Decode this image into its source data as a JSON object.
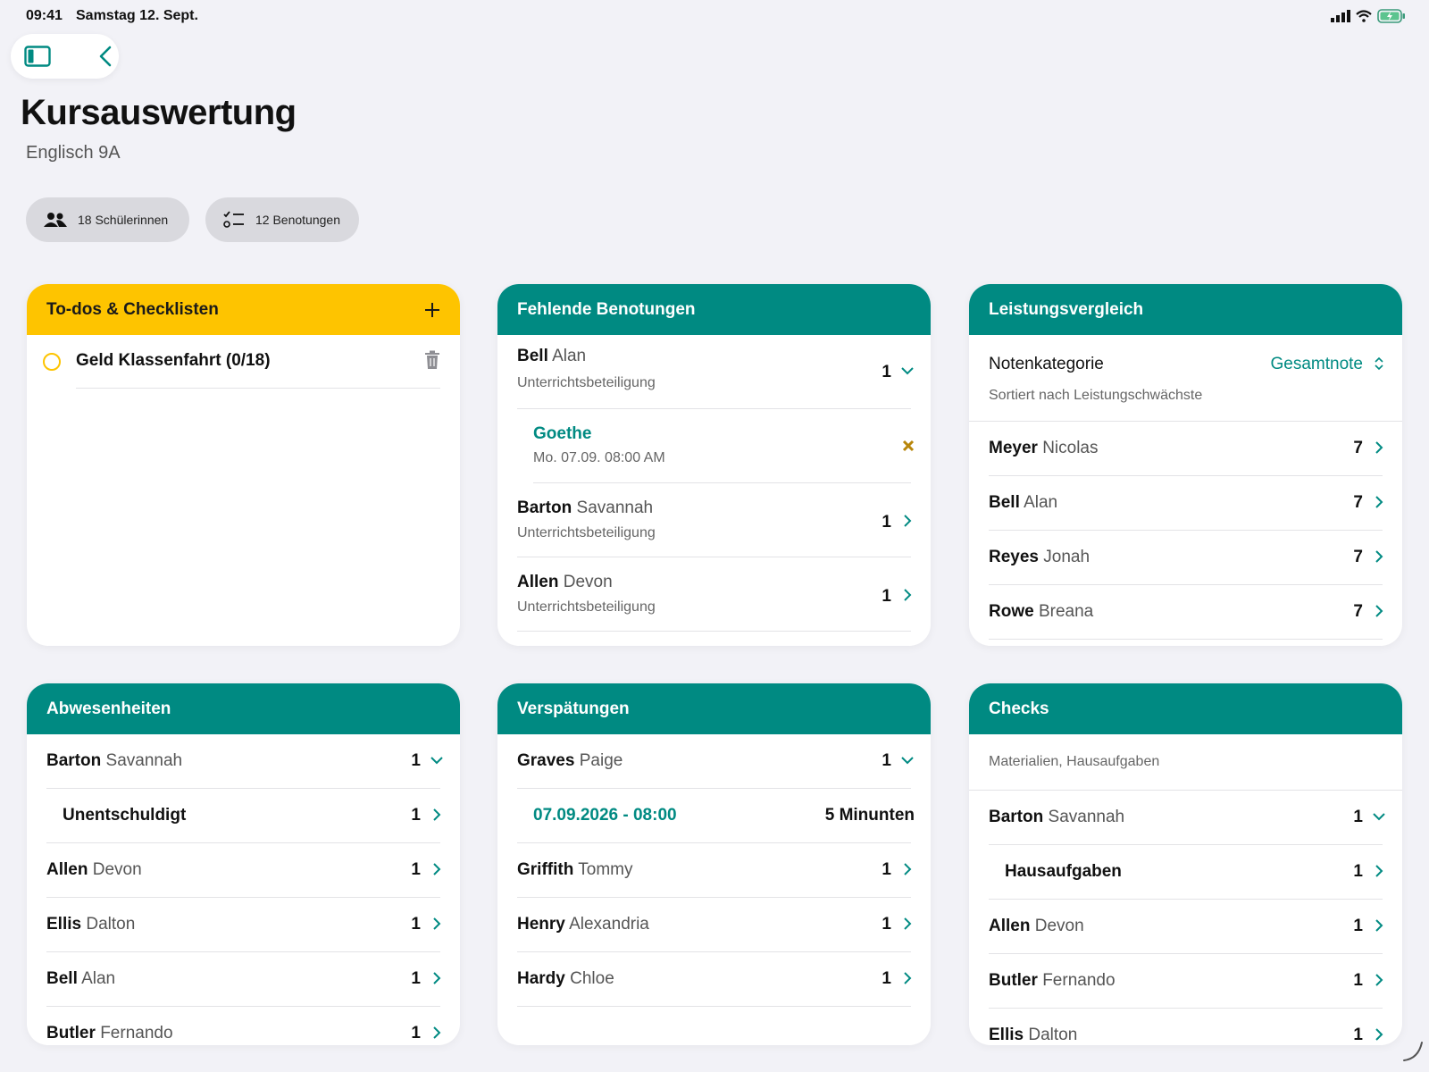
{
  "status": {
    "time": "09:41",
    "date": "Samstag 12. Sept."
  },
  "header": {
    "title": "Kursauswertung",
    "subtitle": "Englisch 9A"
  },
  "chips": {
    "students": "18 Schülerinnen",
    "grades": "12 Benotungen"
  },
  "todos": {
    "title": "To-dos & Checklisten",
    "items": [
      {
        "label": "Geld Klassenfahrt (0/18)"
      }
    ]
  },
  "missing": {
    "title": "Fehlende Benotungen",
    "rows": [
      {
        "last": "Bell",
        "first": "Alan",
        "sub": "Unterrichtsbeteiligung",
        "count": "1"
      },
      {
        "title": "Goethe",
        "sub": "Mo. 07.09. 08:00 AM"
      },
      {
        "last": "Barton",
        "first": "Savannah",
        "sub": "Unterrichtsbeteiligung",
        "count": "1"
      },
      {
        "last": "Allen",
        "first": "Devon",
        "sub": "Unterrichtsbeteiligung",
        "count": "1"
      }
    ]
  },
  "performance": {
    "title": "Leistungsvergleich",
    "category_label": "Notenkategorie",
    "category_value": "Gesamtnote",
    "sort_note": "Sortiert nach Leistungschwächste",
    "rows": [
      {
        "last": "Meyer",
        "first": "Nicolas",
        "count": "7"
      },
      {
        "last": "Bell",
        "first": "Alan",
        "count": "7"
      },
      {
        "last": "Reyes",
        "first": "Jonah",
        "count": "7"
      },
      {
        "last": "Rowe",
        "first": "Breana",
        "count": "7"
      }
    ]
  },
  "absences": {
    "title": "Abwesenheiten",
    "rows": [
      {
        "last": "Barton",
        "first": "Savannah",
        "count": "1"
      },
      {
        "label": "Unentschuldigt",
        "count": "1"
      },
      {
        "last": "Allen",
        "first": "Devon",
        "count": "1"
      },
      {
        "last": "Ellis",
        "first": "Dalton",
        "count": "1"
      },
      {
        "last": "Bell",
        "first": "Alan",
        "count": "1"
      },
      {
        "last": "Butler",
        "first": "Fernando",
        "count": "1"
      }
    ]
  },
  "late": {
    "title": "Verspätungen",
    "rows": [
      {
        "last": "Graves",
        "first": "Paige",
        "count": "1"
      },
      {
        "date": "07.09.2026 - 08:00",
        "value": "5 Minunten"
      },
      {
        "last": "Griffith",
        "first": "Tommy",
        "count": "1"
      },
      {
        "last": "Henry",
        "first": "Alexandria",
        "count": "1"
      },
      {
        "last": "Hardy",
        "first": "Chloe",
        "count": "1"
      }
    ]
  },
  "checks": {
    "title": "Checks",
    "note": "Materialien, Hausaufgaben",
    "rows": [
      {
        "last": "Barton",
        "first": "Savannah",
        "count": "1"
      },
      {
        "label": "Hausaufgaben",
        "count": "1"
      },
      {
        "last": "Allen",
        "first": "Devon",
        "count": "1"
      },
      {
        "last": "Butler",
        "first": "Fernando",
        "count": "1"
      },
      {
        "last": "Ellis",
        "first": "Dalton",
        "count": "1"
      }
    ]
  },
  "colors": {
    "accent": "#008a82",
    "todo": "#fec400",
    "background": "#f2f2f7"
  }
}
